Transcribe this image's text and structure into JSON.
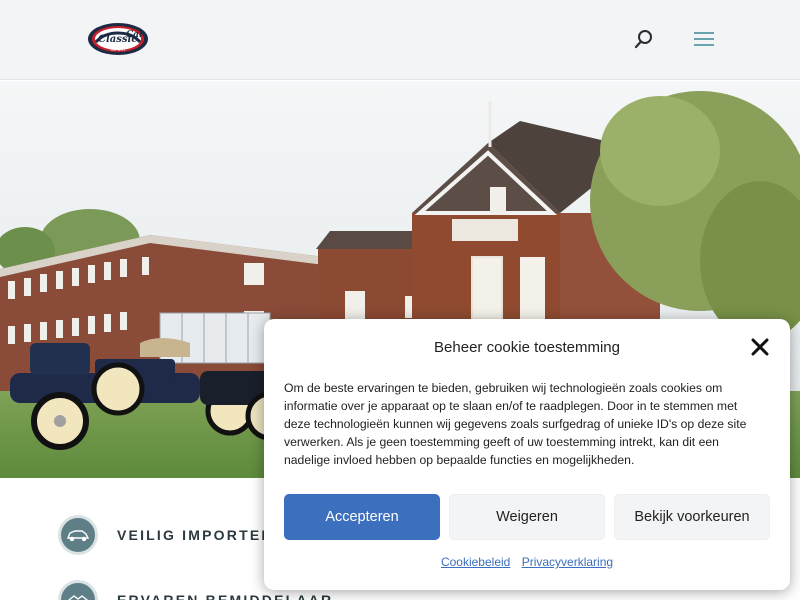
{
  "header": {
    "logo_text_line1": "Classic",
    "logo_text_line2": "Car",
    "logo_subtext": "IMPORT"
  },
  "features": [
    {
      "label": "VEILIG IMPORTEREN",
      "icon": "car-icon"
    },
    {
      "label": "ERVAREN BEMIDDELAAR",
      "icon": "handshake-icon"
    }
  ],
  "cookie": {
    "title": "Beheer cookie toestemming",
    "body": "Om de beste ervaringen te bieden, gebruiken wij technologieën zoals cookies om informatie over je apparaat op te slaan en/of te raadplegen. Door in te stemmen met deze technologieën kunnen wij gegevens zoals surfgedrag of unieke ID's op deze site verwerken. Als je geen toestemming geeft of uw toestemming intrekt, kan dit een nadelige invloed hebben op bepaalde functies en mogelijkheden.",
    "accept_label": "Accepteren",
    "deny_label": "Weigeren",
    "prefs_label": "Bekijk voorkeuren",
    "link_cookie": "Cookiebeleid",
    "link_privacy": "Privacyverklaring"
  },
  "colors": {
    "accent": "#3c6fbd",
    "header_bg": "#f2f4f5",
    "menu_icon": "#6aa3b0",
    "feature_icon_bg": "#5f7f86"
  }
}
